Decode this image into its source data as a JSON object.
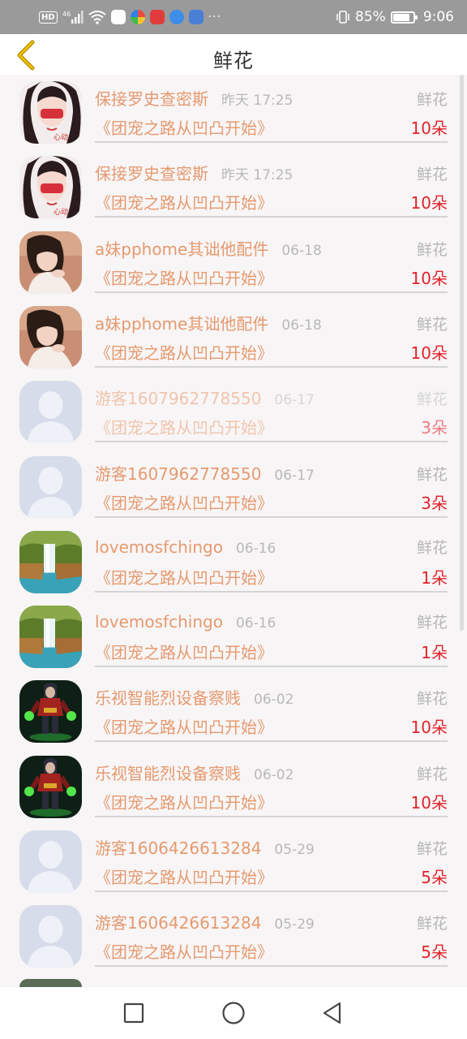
{
  "status_bar": {
    "network_label": "HD",
    "signal_label": "46",
    "apps_overflow": "···",
    "battery_percent_text": "85%",
    "battery_level": 0.85,
    "time": "9:06"
  },
  "header": {
    "title": "鲜花",
    "back_icon": "chevron-left-icon"
  },
  "list": {
    "items": [
      {
        "username": "保接罗史查密斯",
        "time": "昨天 17:25",
        "gift_type": "鲜花",
        "book": "《团宠之路从凹凸开始》",
        "count": "10朵",
        "avatar": "girl-red-avatar"
      },
      {
        "username": "保接罗史查密斯",
        "time": "昨天 17:25",
        "gift_type": "鲜花",
        "book": "《团宠之路从凹凸开始》",
        "count": "10朵",
        "avatar": "girl-red-avatar"
      },
      {
        "username": "a妹pphome其诎他配件",
        "time": "06-18",
        "gift_type": "鲜花",
        "book": "《团宠之路从凹凸开始》",
        "count": "10朵",
        "avatar": "girl-brown-avatar"
      },
      {
        "username": "a妹pphome其诎他配件",
        "time": "06-18",
        "gift_type": "鲜花",
        "book": "《团宠之路从凹凸开始》",
        "count": "10朵",
        "avatar": "girl-brown-avatar"
      },
      {
        "username": "游客1607962778550",
        "time": "06-17",
        "gift_type": "鲜花",
        "book": "《团宠之路从凹凸开始》",
        "count": "3朵",
        "avatar": "default-avatar"
      },
      {
        "username": "游客1607962778550",
        "time": "06-17",
        "gift_type": "鲜花",
        "book": "《团宠之路从凹凸开始》",
        "count": "3朵",
        "avatar": "default-avatar"
      },
      {
        "username": "lovemosfchingo",
        "time": "06-16",
        "gift_type": "鲜花",
        "book": "《团宠之路从凹凸开始》",
        "count": "1朵",
        "avatar": "waterfall-avatar"
      },
      {
        "username": "lovemosfchingo",
        "time": "06-16",
        "gift_type": "鲜花",
        "book": "《团宠之路从凹凸开始》",
        "count": "1朵",
        "avatar": "waterfall-avatar"
      },
      {
        "username": "乐视智能烈设备察贱",
        "time": "06-02",
        "gift_type": "鲜花",
        "book": "《团宠之路从凹凸开始》",
        "count": "10朵",
        "avatar": "game-character-avatar"
      },
      {
        "username": "乐视智能烈设备察贱",
        "time": "06-02",
        "gift_type": "鲜花",
        "book": "《团宠之路从凹凸开始》",
        "count": "10朵",
        "avatar": "game-character-avatar"
      },
      {
        "username": "游客1606426613284",
        "time": "05-29",
        "gift_type": "鲜花",
        "book": "《团宠之路从凹凸开始》",
        "count": "5朵",
        "avatar": "default-avatar"
      },
      {
        "username": "游客1606426613284",
        "time": "05-29",
        "gift_type": "鲜花",
        "book": "《团宠之路从凹凸开始》",
        "count": "5朵",
        "avatar": "default-avatar"
      }
    ]
  },
  "colors": {
    "accent": "#e59a6f",
    "count_red": "#e2232a",
    "muted_gray": "#b6b6b6",
    "status_bar_bg": "#9a9a9a"
  },
  "nav_bar": {
    "recents_icon": "square-icon",
    "home_icon": "circle-icon",
    "back_icon": "triangle-back-icon"
  }
}
